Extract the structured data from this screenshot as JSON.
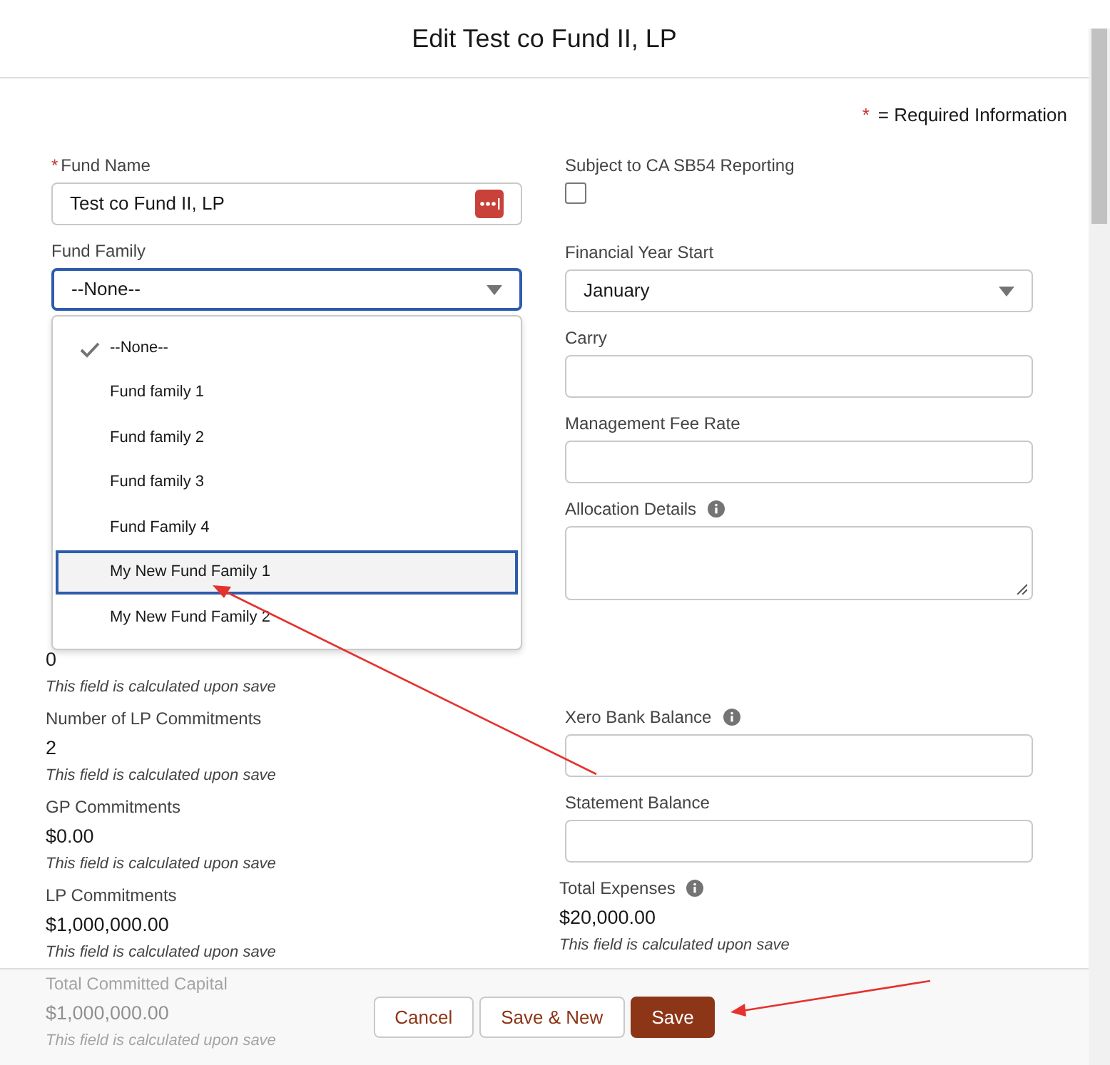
{
  "title": "Edit Test co Fund II, LP",
  "required_note": {
    "mark": "*",
    "text": "= Required Information"
  },
  "left_column": [
    {
      "kind": "text",
      "label": "Fund Name",
      "required_mark": "*",
      "value": "Test co Fund II, LP"
    },
    {
      "kind": "select",
      "label": "Fund Family",
      "value": "--None--",
      "focused": true,
      "expanded": true,
      "options": [
        {
          "label": "--None--",
          "selected": true,
          "focused": false
        },
        {
          "label": "Fund family 1",
          "selected": false,
          "focused": false
        },
        {
          "label": "Fund family 2",
          "selected": false,
          "focused": false
        },
        {
          "label": "Fund family 3",
          "selected": false,
          "focused": false
        },
        {
          "label": "Fund Family 4",
          "selected": false,
          "focused": false
        },
        {
          "label": "My New Fund Family 1",
          "selected": false,
          "focused": true
        },
        {
          "label": "My New Fund Family 2",
          "selected": false,
          "focused": false
        }
      ]
    },
    {
      "kind": "covered"
    },
    {
      "kind": "calculated",
      "value": "0",
      "note": "This field is calculated upon save"
    },
    {
      "kind": "calculated",
      "label": "Number of LP Commitments",
      "value": "2",
      "note": "This field is calculated upon save"
    },
    {
      "kind": "calculated",
      "label": "GP Commitments",
      "value": "$0.00",
      "note": "This field is calculated upon save"
    },
    {
      "kind": "calculated",
      "label": "LP Commitments",
      "value": "$1,000,000.00",
      "note": "This field is calculated upon save"
    },
    {
      "kind": "calculated",
      "label": "Total Committed Capital",
      "value": "$1,000,000.00",
      "note": "This field is calculated upon save"
    }
  ],
  "right_column": [
    {
      "kind": "checkbox",
      "label": "Subject to CA SB54 Reporting",
      "checked": false
    },
    {
      "kind": "select",
      "label": "Financial Year Start",
      "value": "January",
      "focused": false,
      "expanded": false
    },
    {
      "kind": "input",
      "label": "Carry"
    },
    {
      "kind": "input",
      "label": "Management Fee Rate"
    },
    {
      "kind": "textarea",
      "label": "Allocation Details",
      "info": true
    },
    {
      "kind": "blank"
    },
    {
      "kind": "input",
      "label": "Xero Bank Balance",
      "info": true
    },
    {
      "kind": "input",
      "label": "Statement Balance"
    },
    {
      "kind": "calculated",
      "label": "Total Expenses",
      "info": true,
      "value": "$20,000.00",
      "note": "This field is calculated upon save"
    }
  ],
  "buttons": [
    {
      "label": "Cancel",
      "kind": "neutral"
    },
    {
      "label": "Save & New",
      "kind": "neutral"
    },
    {
      "label": "Save",
      "kind": "brand"
    }
  ]
}
